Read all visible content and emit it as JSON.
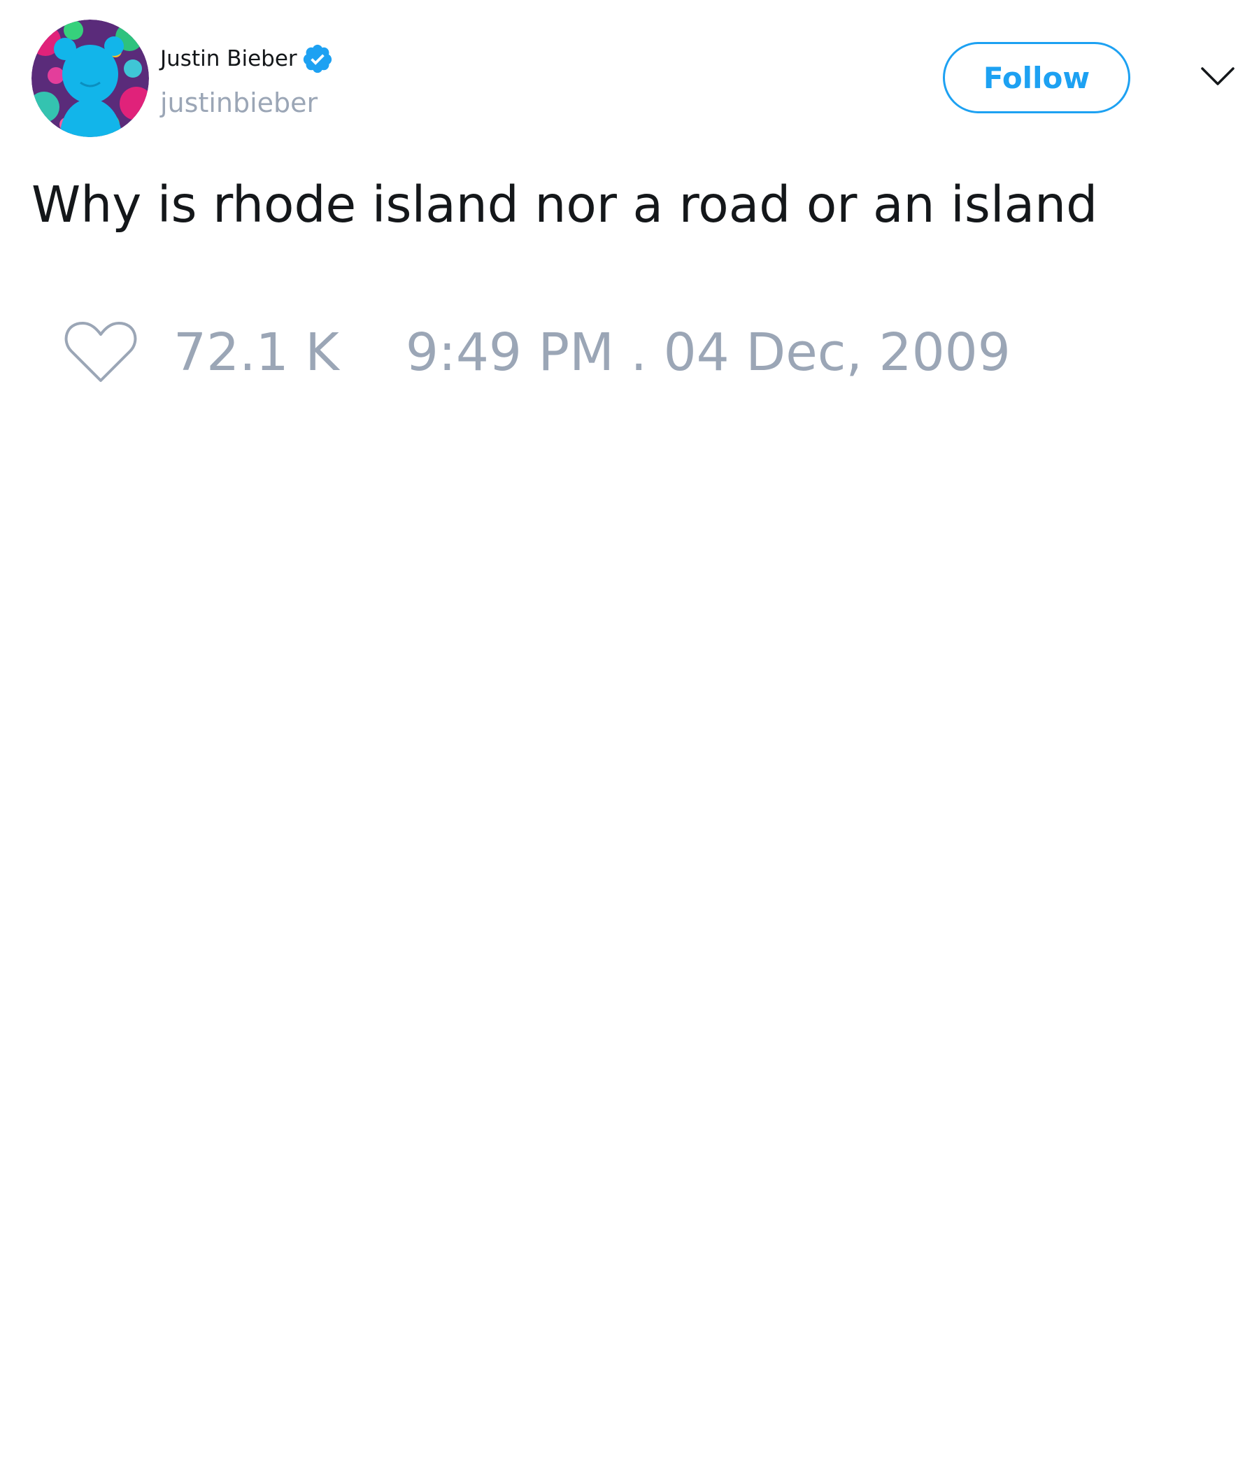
{
  "author": {
    "display_name": "Justin Bieber",
    "handle": "justinbieber",
    "verified": true,
    "avatar_icon": "avatar-silhouette-icon"
  },
  "follow_button": {
    "label": "Follow"
  },
  "menu": {
    "icon": "chevron-down-icon"
  },
  "tweet": {
    "text": "Why is rhode island nor a road or an island",
    "like_count": "72.1 K",
    "timestamp": "9:49 PM . 04 Dec, 2009"
  },
  "colors": {
    "accent": "#1da1f2",
    "muted_text": "#9ba6b6",
    "primary_text": "#14171a",
    "background": "#ffffff"
  }
}
